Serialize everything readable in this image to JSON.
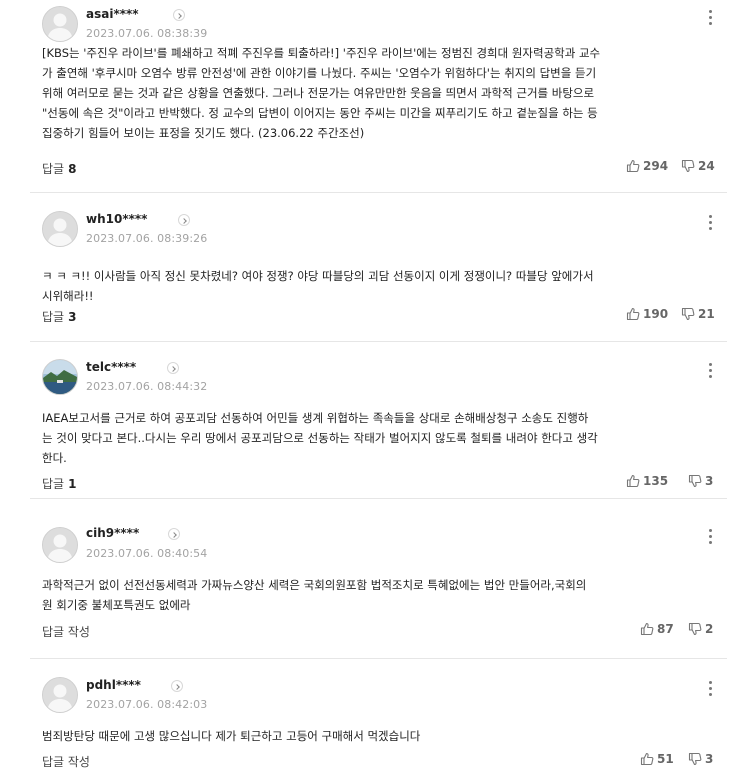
{
  "comments": [
    {
      "username": "asai****",
      "date": "2023.07.06. 08:38:39",
      "text": "[KBS는 '주진우 라이브'를 폐쇄하고 적폐 주진우를 퇴출하라!] '주진우 라이브'에는 정범진 경희대 원자력공학과 교수\n가 출연해 '후쿠시마 오염수 방류 안전성'에 관한 이야기를 나눴다. 주씨는 '오염수가 위험하다'는 취지의 답변을 듣기\n위해 여러모로 묻는 것과 같은 상황을 연출했다. 그러나 전문가는 여유만만한 웃음을 띄면서 과학적 근거를 바탕으로\n\"선동에 속은 것\"이라고 반박했다. 정 교수의 답변이 이어지는 동안 주씨는 미간을 찌푸리기도 하고 곁눈질을 하는 등\n집중하기 힘들어 보이는 표정을 짓기도 했다. (23.06.22 주간조선)",
      "reply_label": "답글",
      "reply_count": "8",
      "likes": "294",
      "dislikes": "24",
      "avatar": "default"
    },
    {
      "username": "wh10****",
      "date": "2023.07.06. 08:39:26",
      "text": "ㅋ ㅋ ㅋ!! 이사람들 아직 정신 못차렸네? 여야 정쟁? 야당 따블당의 괴담 선동이지 이게 정쟁이니? 따블당 앞에가서\n시위해라!!",
      "reply_label": "답글",
      "reply_count": "3",
      "likes": "190",
      "dislikes": "21",
      "avatar": "default"
    },
    {
      "username": "telc****",
      "date": "2023.07.06. 08:44:32",
      "text": "IAEA보고서를 근거로 하여 공포괴담 선동하여 어민들 생계 위협하는 족속들을 상대로 손해배상청구 소송도 진행하\n는 것이 맞다고 본다..다시는 우리 땅에서 공포괴담으로 선동하는 작태가 벌어지지 않도록 철퇴를 내려야 한다고 생각\n한다.",
      "reply_label": "답글",
      "reply_count": "1",
      "likes": "135",
      "dislikes": "3",
      "avatar": "landscape"
    },
    {
      "username": "cih9****",
      "date": "2023.07.06. 08:40:54",
      "text": "과학적근거 없이 선전선동세력과 가짜뉴스양산 세력은 국회의원포함 법적조치로 특혜없에는 법안 만들어라,국회의\n원 회기중 불체포특권도 없에라",
      "reply_label": "답글 작성",
      "reply_count": "",
      "likes": "87",
      "dislikes": "2",
      "avatar": "default"
    },
    {
      "username": "pdhl****",
      "date": "2023.07.06. 08:42:03",
      "text": "범죄방탄당 때문에 고생 많으십니다 제가 퇴근하고 고등어 구매해서 먹겠습니다",
      "reply_label": "답글 작성",
      "reply_count": "",
      "likes": "51",
      "dislikes": "3",
      "avatar": "default"
    }
  ]
}
